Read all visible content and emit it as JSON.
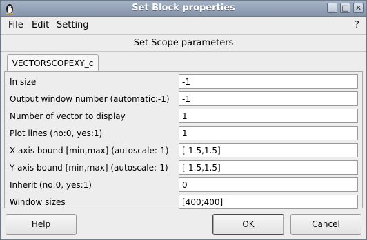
{
  "window": {
    "title": "Set Block properties",
    "controls": {
      "minimize": "_",
      "maximize": "□",
      "close": "✕"
    }
  },
  "menu": {
    "items": [
      {
        "label": "File"
      },
      {
        "label": "Edit"
      },
      {
        "label": "Setting"
      }
    ],
    "help": "?"
  },
  "dialog": {
    "subtitle": "Set Scope parameters",
    "tab": "VECTORSCOPEXY_c",
    "fields": [
      {
        "label": "In size",
        "value": "-1"
      },
      {
        "label": "Output window number (automatic:-1)",
        "value": "-1"
      },
      {
        "label": "Number of vector to display",
        "value": "1"
      },
      {
        "label": "Plot lines (no:0, yes:1)",
        "value": "1"
      },
      {
        "label": "X axis bound [min,max] (autoscale:-1)",
        "value": "[-1.5,1.5]"
      },
      {
        "label": "Y axis bound [min,max] (autoscale:-1)",
        "value": "[-1.5,1.5]"
      },
      {
        "label": "Inherit (no:0, yes:1)",
        "value": "0"
      },
      {
        "label": "Window sizes",
        "value": "[400;400]"
      }
    ]
  },
  "buttons": {
    "help": "Help",
    "ok": "OK",
    "cancel": "Cancel"
  }
}
